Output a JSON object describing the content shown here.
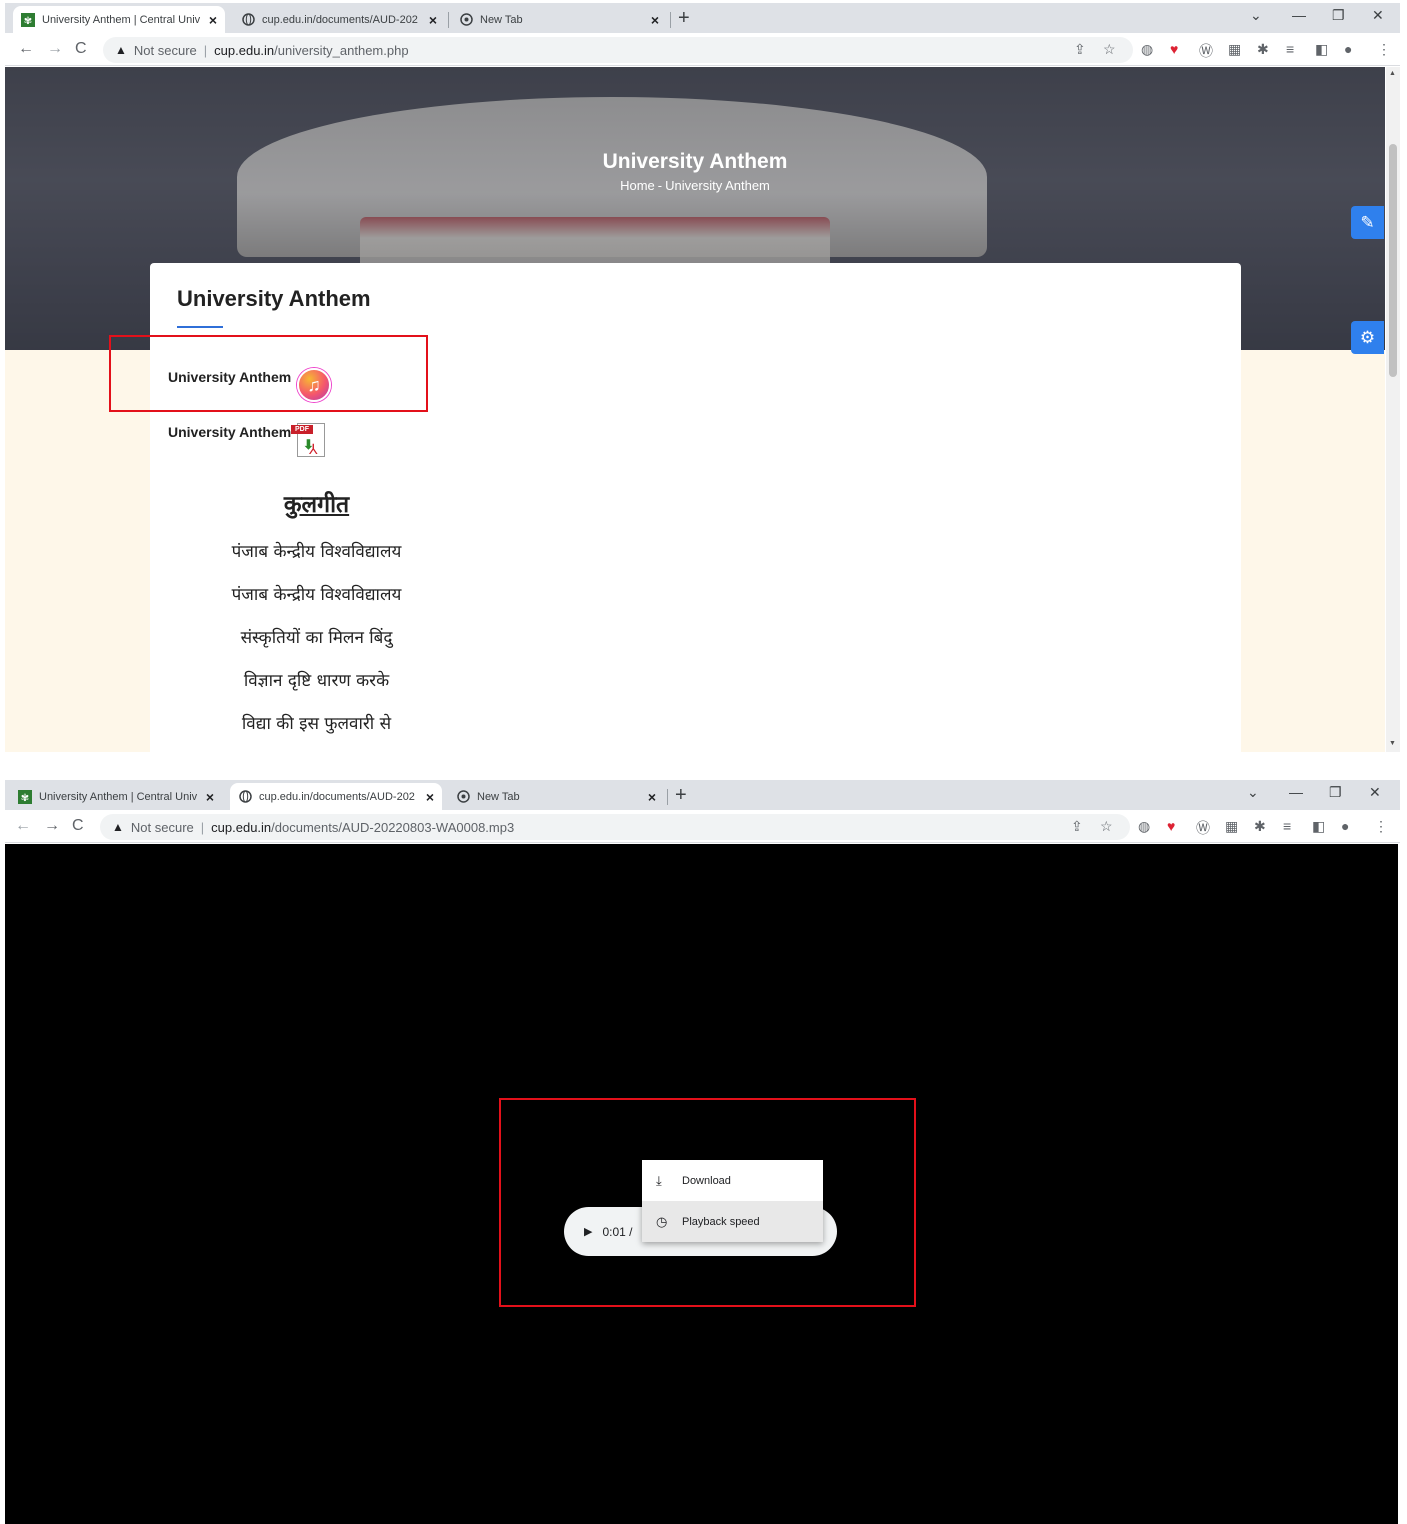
{
  "top": {
    "tabs": [
      {
        "title": "University Anthem | Central Univ",
        "active": true
      },
      {
        "title": "cup.edu.in/documents/AUD-202",
        "active": false
      },
      {
        "title": "New Tab",
        "active": false
      }
    ],
    "address": {
      "warning": "Not secure",
      "host": "cup.edu.in",
      "path": "/university_anthem.php"
    },
    "hero": {
      "title": "University Anthem",
      "breadcrumb_home": "Home",
      "breadcrumb_sep": "-",
      "breadcrumb_current": "University Anthem"
    },
    "card": {
      "title": "University Anthem",
      "audio_link_label": "University Anthem",
      "pdf_link_label": "University Anthem",
      "pdf_badge": "PDF",
      "hindi_title": "कुलगीत",
      "hindi_lines": [
        "पंजाब केन्द्रीय विश्वविद्यालय",
        "पंजाब केन्द्रीय विश्वविद्यालय",
        "संस्कृतियों का मिलन बिंदु",
        "विज्ञान दृष्टि धारण करके",
        "विद्या की इस फुलवारी से"
      ]
    }
  },
  "bottom": {
    "tabs": [
      {
        "title": "University Anthem | Central Univ",
        "active": false
      },
      {
        "title": "cup.edu.in/documents/AUD-202",
        "active": true
      },
      {
        "title": "New Tab",
        "active": false
      }
    ],
    "address": {
      "warning": "Not secure",
      "host": "cup.edu.in",
      "path": "/documents/AUD-20220803-WA0008.mp3"
    },
    "player": {
      "time": "0:01 /"
    },
    "menu": [
      {
        "label": "Download",
        "icon": "download-icon"
      },
      {
        "label": "Playback speed",
        "icon": "playback-speed-icon"
      }
    ]
  },
  "colors": {
    "accent": "#2f80ed",
    "highlight": "#e3101a",
    "page_bg": "#fef7e9"
  }
}
